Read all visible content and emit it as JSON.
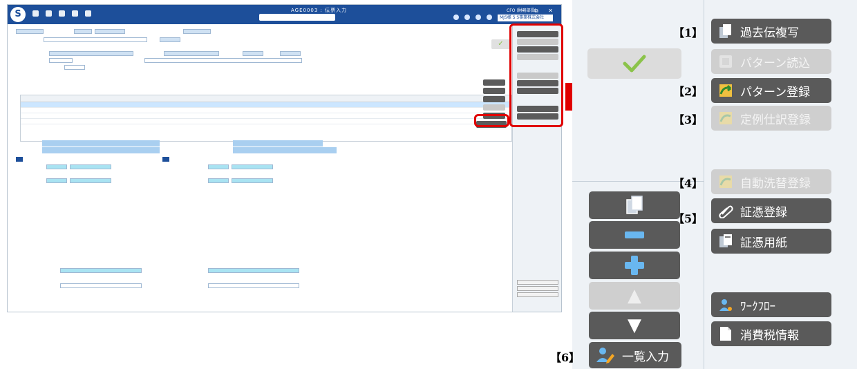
{
  "app": {
    "window_title": "AGE0003 : 伝票入力",
    "user": "CFO (財務部長)",
    "company": "MJS様 S S事業株式会社",
    "logo": "S"
  },
  "callout": {
    "markers": [
      "【1】",
      "【2】",
      "【3】",
      "【4】",
      "【5】",
      "【6】"
    ]
  },
  "side_buttons": {
    "copy_past": "過去伝複写",
    "pattern_load": "パターン読込",
    "pattern_register": "パターン登録",
    "recurring_register": "定例仕訳登録",
    "auto_reversal": "自動洗替登録",
    "voucher_register": "証憑登録",
    "voucher_paper": "証憑用紙",
    "workflow": "ﾜｰｸﾌﾛｰ",
    "tax_info": "消費税情報"
  },
  "nav": {
    "check": "✓",
    "up": "▲",
    "down": "▼",
    "list_input": "一覧入力"
  },
  "colors": {
    "button_active": "#5a5a5a",
    "button_disabled": "#cfcfcf",
    "highlight_red": "#e00000",
    "title_bar": "#1d4f9a"
  }
}
